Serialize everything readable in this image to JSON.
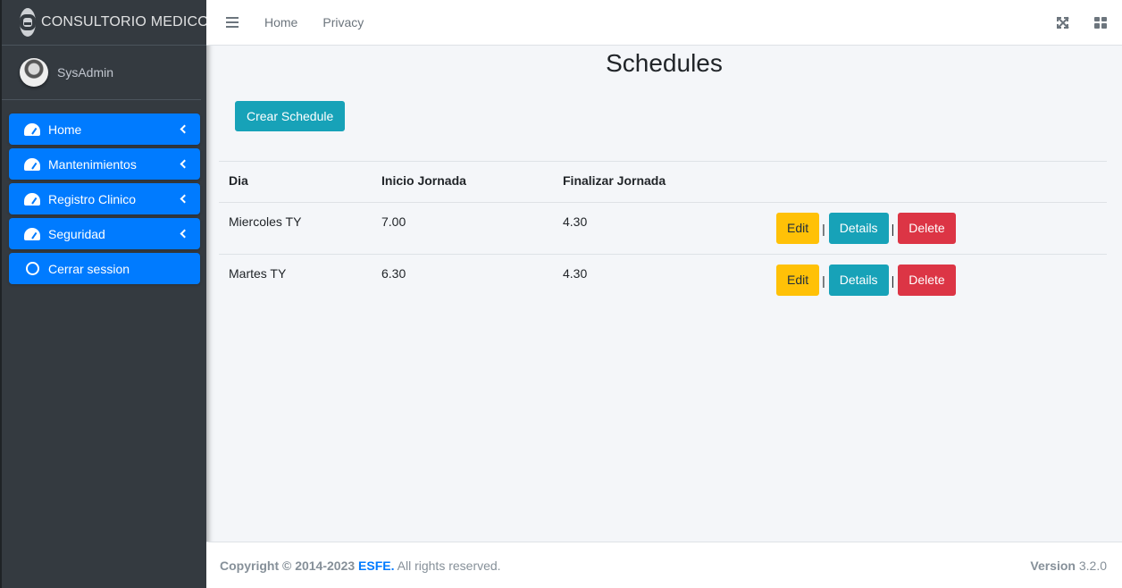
{
  "brand": {
    "title": "CONSULTORIO MEDICO"
  },
  "user": {
    "name": "SysAdmin"
  },
  "sidebar": {
    "items": [
      {
        "label": "Home"
      },
      {
        "label": "Mantenimientos"
      },
      {
        "label": "Registro Clinico"
      },
      {
        "label": "Seguridad"
      },
      {
        "label": "Cerrar session"
      }
    ]
  },
  "topnav": {
    "links": [
      "Home",
      "Privacy"
    ]
  },
  "page": {
    "title": "Schedules",
    "create_label": "Crear Schedule"
  },
  "table": {
    "headers": [
      "Dia",
      "Inicio Jornada",
      "Finalizar Jornada"
    ],
    "rows": [
      {
        "dia": "Miercoles TY",
        "inicio": "7.00",
        "fin": "4.30"
      },
      {
        "dia": "Martes TY",
        "inicio": "6.30",
        "fin": "4.30"
      }
    ],
    "actions": {
      "edit": "Edit",
      "details": "Details",
      "delete": "Delete",
      "separator": "|"
    }
  },
  "footer": {
    "copyright": "Copyright © 2014-2023",
    "org": "ESFE.",
    "rights": "All rights reserved.",
    "version_label": "Version",
    "version_value": "3.2.0"
  },
  "colors": {
    "primary": "#007bff",
    "info": "#17a2b8",
    "warning": "#ffc107",
    "danger": "#dc3545",
    "sidebar_bg": "#343a40"
  }
}
